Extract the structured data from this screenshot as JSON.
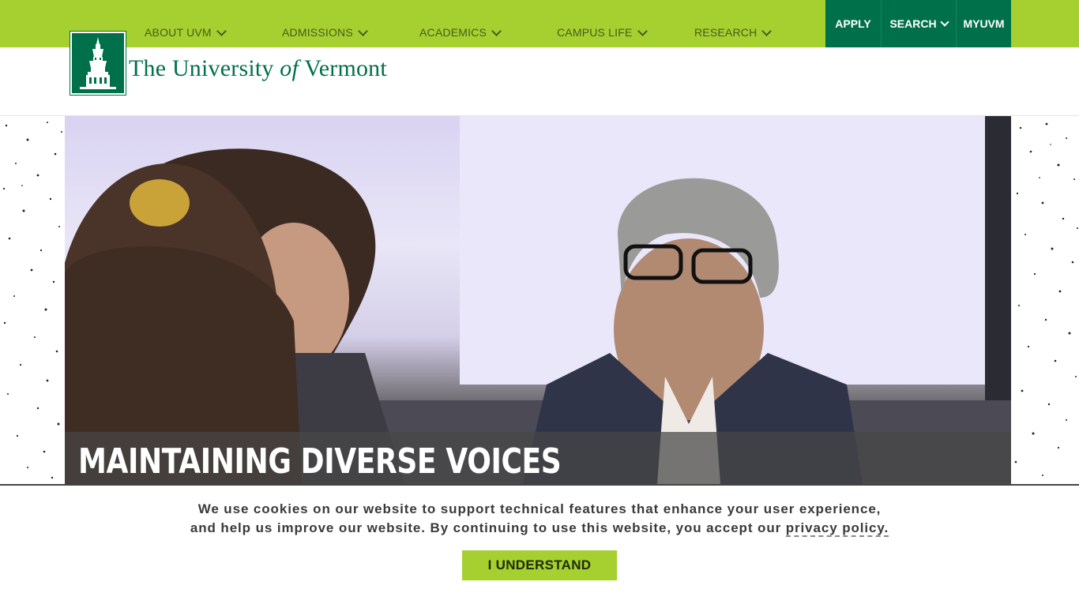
{
  "nav": {
    "items": [
      {
        "label": "ABOUT UVM"
      },
      {
        "label": "ADMISSIONS"
      },
      {
        "label": "ACADEMICS"
      },
      {
        "label": "CAMPUS LIFE"
      },
      {
        "label": "RESEARCH"
      }
    ],
    "utility": {
      "apply": "APPLY",
      "search": "SEARCH",
      "myuvm": "MYUVM"
    }
  },
  "brand": {
    "pre": "The University ",
    "of": "of",
    "post": " Vermont",
    "logo_icon": "bell-tower-icon",
    "green": "#00704a",
    "lime": "#a6d02f"
  },
  "hero": {
    "title": "MAINTAINING DIVERSE VOICES"
  },
  "cookie": {
    "line1": "We use cookies on our website to support technical features that enhance your user experience,",
    "line2": "and help us improve our website. By continuing to use this website, you accept our ",
    "link": "privacy policy.",
    "button": "I UNDERSTAND"
  }
}
